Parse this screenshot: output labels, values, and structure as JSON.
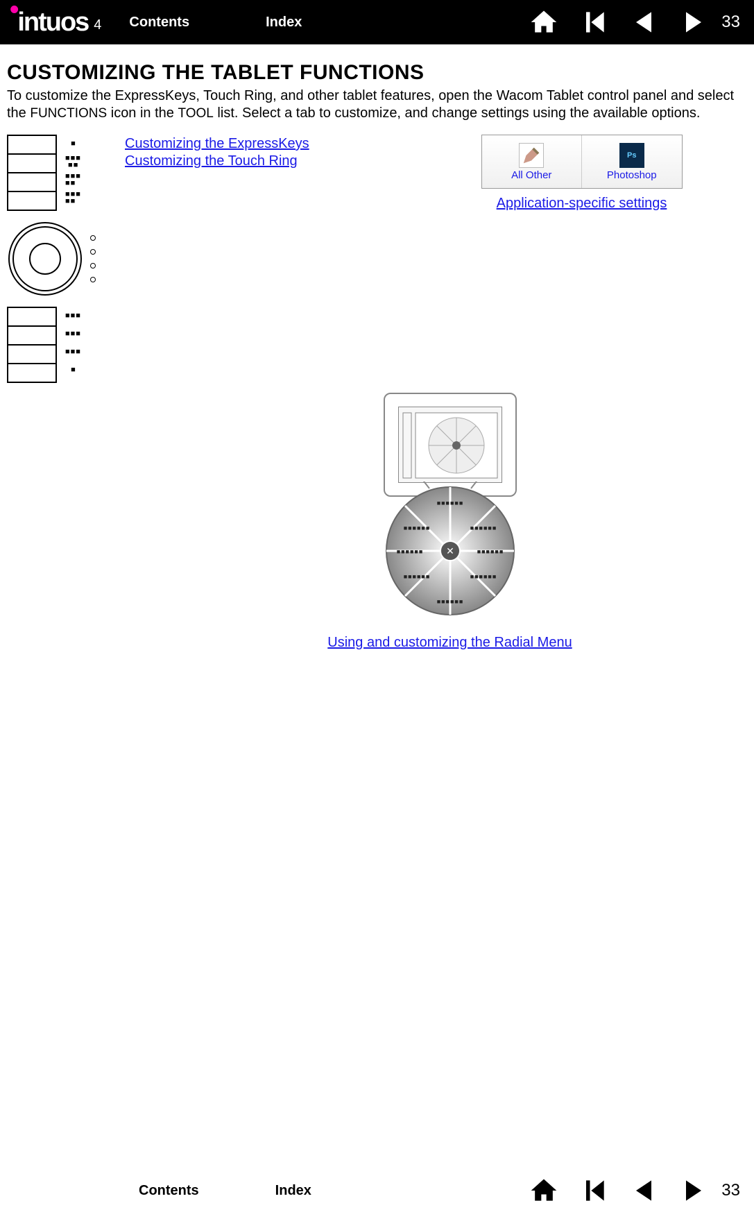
{
  "brand": {
    "name": "intuos",
    "sub": "4"
  },
  "nav": {
    "contents": "Contents",
    "index": "Index",
    "page": "33"
  },
  "heading": "CUSTOMIZING THE TABLET FUNCTIONS",
  "intro": {
    "p1a": "To customize the ExpressKeys, Touch Ring, and other tablet features, open the Wacom Tablet control panel and select the ",
    "sc1": "FUNCTIONS",
    "p1b": " icon in the ",
    "sc2": "TOOL",
    "p1c": " list.  Select a tab to customize, and change settings using the available options."
  },
  "links": {
    "expresskeys": "Customizing the ExpressKeys",
    "touchring": "Customizing the Touch Ring",
    "appsettings": "Application-specific settings",
    "radial": "Using and customizing the Radial Menu"
  },
  "apps": {
    "allother": "All Other",
    "photoshop": "Photoshop",
    "psAbbrev": "Ps"
  }
}
